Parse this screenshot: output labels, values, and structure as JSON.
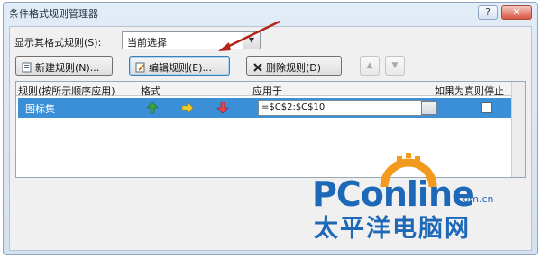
{
  "window": {
    "title": "条件格式规则管理器",
    "help_label": "?",
    "close_label": "✕"
  },
  "scope": {
    "label": "显示其格式规则(S):",
    "value": "当前选择"
  },
  "toolbar": {
    "new_label": "新建规则(N)...",
    "edit_label": "编辑规则(E)...",
    "delete_label": "删除规则(D)",
    "up_label": "▲",
    "down_label": "▼"
  },
  "grid": {
    "headers": {
      "rule": "规则(按所示顺序应用)",
      "format": "格式",
      "applies_to": "应用于",
      "stop_if_true": "如果为真则停止"
    },
    "rows": [
      {
        "rule": "图标集",
        "icons": [
          "green-up-arrow-icon",
          "yellow-side-arrow-icon",
          "red-down-arrow-icon"
        ],
        "applies_to": "=$C$2:$C$10",
        "stop_if_true": false
      }
    ]
  },
  "watermark": {
    "brand": "PConline",
    "domain": ".com.cn",
    "chinese": "太平洋电脑网"
  },
  "colors": {
    "selection": "#3a8fd6",
    "brand_blue": "#1d69b7",
    "brand_orange": "#f29a1d",
    "annotation_red": "#b3231a"
  }
}
